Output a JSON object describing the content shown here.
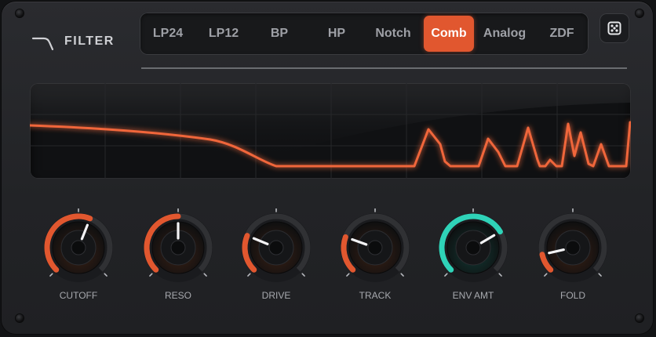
{
  "header": {
    "title": "FILTER",
    "logo_icon": "filter-curve-icon"
  },
  "filter_types": [
    {
      "label": "LP24",
      "active": false
    },
    {
      "label": "LP12",
      "active": false
    },
    {
      "label": "BP",
      "active": false
    },
    {
      "label": "HP",
      "active": false
    },
    {
      "label": "Notch",
      "active": false
    },
    {
      "label": "Comb",
      "active": true
    },
    {
      "label": "Analog",
      "active": false
    },
    {
      "label": "ZDF",
      "active": false
    }
  ],
  "randomize_button": {
    "icon": "dice-icon"
  },
  "colors": {
    "accent": "#e1572f",
    "env": "#2fd3b8",
    "text": "#cfd0d4",
    "panel": "#232427"
  },
  "knobs": [
    {
      "label": "CUTOFF",
      "value": 0.58,
      "color": "#e1572f"
    },
    {
      "label": "RESO",
      "value": 0.5,
      "color": "#e1572f"
    },
    {
      "label": "DRIVE",
      "value": 0.25,
      "color": "#e1572f"
    },
    {
      "label": "TRACK",
      "value": 0.24,
      "color": "#e1572f"
    },
    {
      "label": "ENV AMT",
      "value": 0.72,
      "color": "#2fd3b8"
    },
    {
      "label": "FOLD",
      "value": 0.12,
      "color": "#e1572f"
    }
  ]
}
